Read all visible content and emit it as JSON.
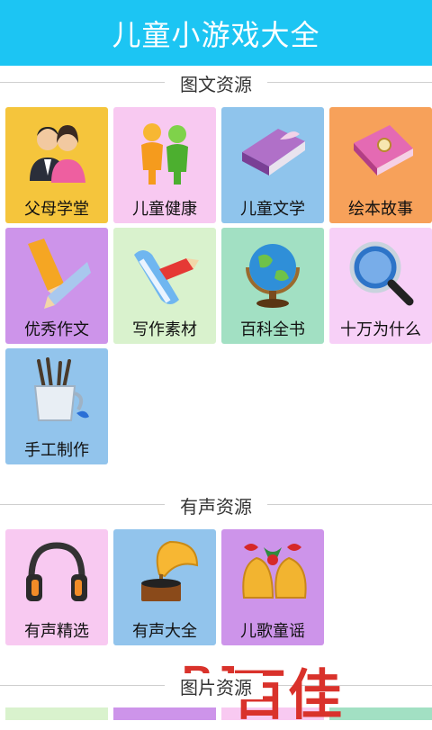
{
  "header": {
    "title": "儿童小游戏大全"
  },
  "sections": {
    "tuwen": {
      "title": "图文资源"
    },
    "yousheng": {
      "title": "有声资源"
    },
    "tupian": {
      "title": "图片资源"
    }
  },
  "tiles": [
    {
      "label": "父母学堂",
      "bg": "#f5c53c",
      "icon": "parents-icon"
    },
    {
      "label": "儿童健康",
      "bg": "#f8c9f1",
      "icon": "children-icon"
    },
    {
      "label": "儿童文学",
      "bg": "#8fc4ec",
      "icon": "book-icon"
    },
    {
      "label": "绘本故事",
      "bg": "#f7a15a",
      "icon": "diary-icon"
    },
    {
      "label": "优秀作文",
      "bg": "#cd94ea",
      "icon": "pencils-icon"
    },
    {
      "label": "写作素材",
      "bg": "#d9f2cd",
      "icon": "paper-roll-icon"
    },
    {
      "label": "百科全书",
      "bg": "#a2e0c3",
      "icon": "globe-icon"
    },
    {
      "label": "十万为什么",
      "bg": "#f7d0f7",
      "icon": "magnifier-icon"
    },
    {
      "label": "手工制作",
      "bg": "#92c4ec",
      "icon": "paint-cup-icon"
    },
    {
      "label": "有声精选",
      "bg": "#f8c9f1",
      "icon": "headphones-icon"
    },
    {
      "label": "有声大全",
      "bg": "#92c4ec",
      "icon": "gramophone-icon"
    },
    {
      "label": "儿歌童谣",
      "bg": "#cd94ea",
      "icon": "bells-icon"
    }
  ],
  "watermark": {
    "text1": "BJ",
    "text2": "百佳"
  }
}
